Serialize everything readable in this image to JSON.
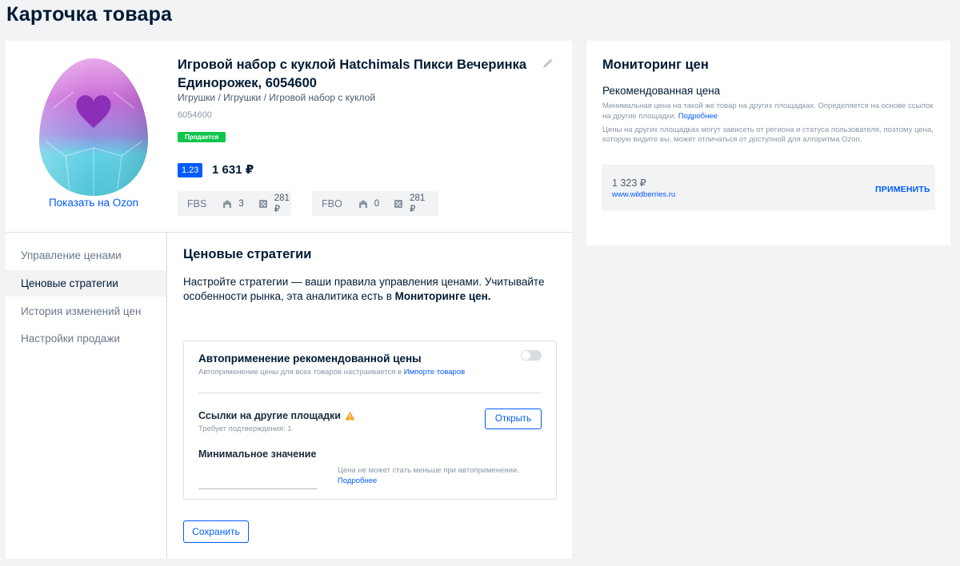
{
  "page": {
    "title": "Карточка товара"
  },
  "product": {
    "image_alt": "Hatchimals egg",
    "show_on_ozon": "Показать на Ozon",
    "title": "Игровой набор с куклой Hatchimals Пикси Вечеринка Единорожек, 6054600",
    "category": "Игрушки / Игрушки / Игровой набор с куклой",
    "sku": "6054600",
    "status_badge": "Продается",
    "rating": "1.23",
    "price": "1 631 ₽",
    "fbs": {
      "label": "FBS",
      "stock": "3",
      "price": "281 ₽"
    },
    "fbo": {
      "label": "FBO",
      "stock": "0",
      "price": "281 ₽"
    }
  },
  "nav": {
    "items": [
      {
        "label": "Управление ценами",
        "active": false
      },
      {
        "label": "Ценовые стратегии",
        "active": true
      },
      {
        "label": "История изменений цен",
        "active": false
      },
      {
        "label": "Настройки продажи",
        "active": false
      }
    ]
  },
  "strategies": {
    "title": "Ценовые стратегии",
    "desc_part1": "Настройте стратегии — ваши правила управления ценами. Учитывайте особенности рынка, эта аналитика есть в ",
    "desc_bold": "Мониторинге цен.",
    "auto_apply": {
      "title": "Автоприменение рекомендованной цены",
      "enabled": false,
      "sub_text": "Автоприменение цены для всех товаров настраивается в ",
      "sub_link": "Импорте товаров"
    },
    "links": {
      "title": "Ссылки на другие площадки",
      "sub": "Требует подтверждения: 1",
      "open_button": "Открыть"
    },
    "min_value": {
      "title": "Минимальное значение",
      "value": "",
      "note": "Цена не может стать меньше при автоприменении.",
      "note_link": "Подробнее"
    },
    "save_button": "Сохранить"
  },
  "monitoring": {
    "title": "Мониторинг цен",
    "subtitle": "Рекомендованная цена",
    "desc1": "Минимальная цена на такой же товар на других площадках. Определяется на основе ссылок на другие площадки. ",
    "desc1_link": "Подробнее",
    "desc2": "Цены на других площадках могут зависеть от региона и статуса пользователя, поэтому цена, которую видите вы, может отличаться от доступной для алгоритма Ozon.",
    "offer": {
      "price": "1 323 ₽",
      "site": "www.wildberries.ru",
      "apply_button": "ПРИМЕНИТЬ"
    }
  },
  "colors": {
    "accent": "#005bff",
    "success": "#10c44c",
    "warning": "#f5a623"
  }
}
